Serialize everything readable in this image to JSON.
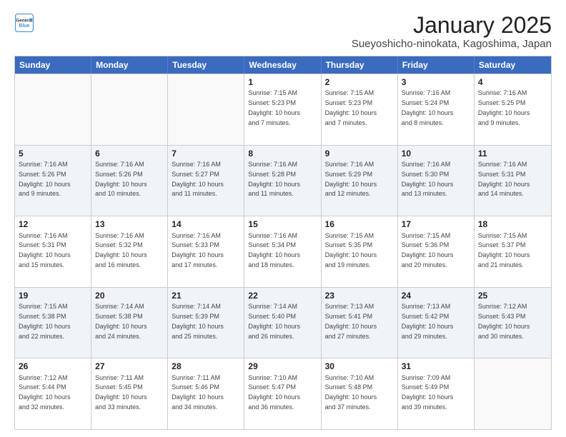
{
  "logo": {
    "line1": "General",
    "line2": "Blue"
  },
  "title": "January 2025",
  "subtitle": "Sueyoshicho-ninokata, Kagoshima, Japan",
  "header_days": [
    "Sunday",
    "Monday",
    "Tuesday",
    "Wednesday",
    "Thursday",
    "Friday",
    "Saturday"
  ],
  "rows": [
    [
      {
        "day": "",
        "text": "",
        "empty": true
      },
      {
        "day": "",
        "text": "",
        "empty": true
      },
      {
        "day": "",
        "text": "",
        "empty": true
      },
      {
        "day": "1",
        "text": "Sunrise: 7:15 AM\nSunset: 5:23 PM\nDaylight: 10 hours\nand 7 minutes."
      },
      {
        "day": "2",
        "text": "Sunrise: 7:15 AM\nSunset: 5:23 PM\nDaylight: 10 hours\nand 7 minutes."
      },
      {
        "day": "3",
        "text": "Sunrise: 7:16 AM\nSunset: 5:24 PM\nDaylight: 10 hours\nand 8 minutes."
      },
      {
        "day": "4",
        "text": "Sunrise: 7:16 AM\nSunset: 5:25 PM\nDaylight: 10 hours\nand 9 minutes."
      }
    ],
    [
      {
        "day": "5",
        "text": "Sunrise: 7:16 AM\nSunset: 5:26 PM\nDaylight: 10 hours\nand 9 minutes."
      },
      {
        "day": "6",
        "text": "Sunrise: 7:16 AM\nSunset: 5:26 PM\nDaylight: 10 hours\nand 10 minutes."
      },
      {
        "day": "7",
        "text": "Sunrise: 7:16 AM\nSunset: 5:27 PM\nDaylight: 10 hours\nand 11 minutes."
      },
      {
        "day": "8",
        "text": "Sunrise: 7:16 AM\nSunset: 5:28 PM\nDaylight: 10 hours\nand 11 minutes."
      },
      {
        "day": "9",
        "text": "Sunrise: 7:16 AM\nSunset: 5:29 PM\nDaylight: 10 hours\nand 12 minutes."
      },
      {
        "day": "10",
        "text": "Sunrise: 7:16 AM\nSunset: 5:30 PM\nDaylight: 10 hours\nand 13 minutes."
      },
      {
        "day": "11",
        "text": "Sunrise: 7:16 AM\nSunset: 5:31 PM\nDaylight: 10 hours\nand 14 minutes."
      }
    ],
    [
      {
        "day": "12",
        "text": "Sunrise: 7:16 AM\nSunset: 5:31 PM\nDaylight: 10 hours\nand 15 minutes."
      },
      {
        "day": "13",
        "text": "Sunrise: 7:16 AM\nSunset: 5:32 PM\nDaylight: 10 hours\nand 16 minutes."
      },
      {
        "day": "14",
        "text": "Sunrise: 7:16 AM\nSunset: 5:33 PM\nDaylight: 10 hours\nand 17 minutes."
      },
      {
        "day": "15",
        "text": "Sunrise: 7:16 AM\nSunset: 5:34 PM\nDaylight: 10 hours\nand 18 minutes."
      },
      {
        "day": "16",
        "text": "Sunrise: 7:15 AM\nSunset: 5:35 PM\nDaylight: 10 hours\nand 19 minutes."
      },
      {
        "day": "17",
        "text": "Sunrise: 7:15 AM\nSunset: 5:36 PM\nDaylight: 10 hours\nand 20 minutes."
      },
      {
        "day": "18",
        "text": "Sunrise: 7:15 AM\nSunset: 5:37 PM\nDaylight: 10 hours\nand 21 minutes."
      }
    ],
    [
      {
        "day": "19",
        "text": "Sunrise: 7:15 AM\nSunset: 5:38 PM\nDaylight: 10 hours\nand 22 minutes."
      },
      {
        "day": "20",
        "text": "Sunrise: 7:14 AM\nSunset: 5:38 PM\nDaylight: 10 hours\nand 24 minutes."
      },
      {
        "day": "21",
        "text": "Sunrise: 7:14 AM\nSunset: 5:39 PM\nDaylight: 10 hours\nand 25 minutes."
      },
      {
        "day": "22",
        "text": "Sunrise: 7:14 AM\nSunset: 5:40 PM\nDaylight: 10 hours\nand 26 minutes."
      },
      {
        "day": "23",
        "text": "Sunrise: 7:13 AM\nSunset: 5:41 PM\nDaylight: 10 hours\nand 27 minutes."
      },
      {
        "day": "24",
        "text": "Sunrise: 7:13 AM\nSunset: 5:42 PM\nDaylight: 10 hours\nand 29 minutes."
      },
      {
        "day": "25",
        "text": "Sunrise: 7:12 AM\nSunset: 5:43 PM\nDaylight: 10 hours\nand 30 minutes."
      }
    ],
    [
      {
        "day": "26",
        "text": "Sunrise: 7:12 AM\nSunset: 5:44 PM\nDaylight: 10 hours\nand 32 minutes."
      },
      {
        "day": "27",
        "text": "Sunrise: 7:11 AM\nSunset: 5:45 PM\nDaylight: 10 hours\nand 33 minutes."
      },
      {
        "day": "28",
        "text": "Sunrise: 7:11 AM\nSunset: 5:46 PM\nDaylight: 10 hours\nand 34 minutes."
      },
      {
        "day": "29",
        "text": "Sunrise: 7:10 AM\nSunset: 5:47 PM\nDaylight: 10 hours\nand 36 minutes."
      },
      {
        "day": "30",
        "text": "Sunrise: 7:10 AM\nSunset: 5:48 PM\nDaylight: 10 hours\nand 37 minutes."
      },
      {
        "day": "31",
        "text": "Sunrise: 7:09 AM\nSunset: 5:49 PM\nDaylight: 10 hours\nand 39 minutes."
      },
      {
        "day": "",
        "text": "",
        "empty": true
      }
    ]
  ]
}
